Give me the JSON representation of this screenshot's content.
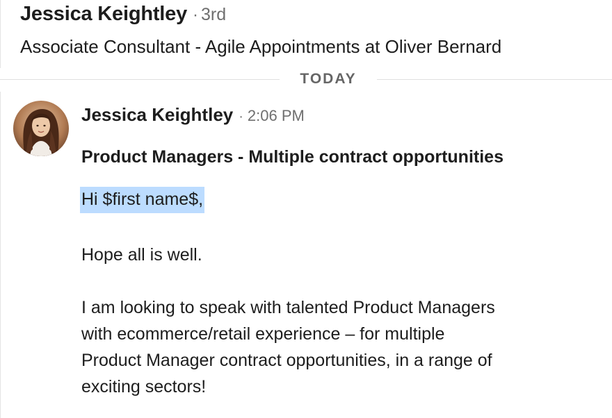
{
  "header": {
    "name": "Jessica Keightley",
    "separator": "·",
    "degree": "3rd",
    "headline": "Associate Consultant - Agile Appointments at Oliver Bernard"
  },
  "divider": {
    "label": "TODAY"
  },
  "message": {
    "avatar_icon": "profile-photo",
    "sender": "Jessica Keightley",
    "separator": "·",
    "time": "2:06 PM",
    "subject": "Product Managers - Multiple contract opportunities",
    "greeting": "Hi $first name$,",
    "paragraph_1": "Hope all is well.",
    "paragraph_2_lines": [
      "I am looking to speak with talented Product Managers",
      "with ecommerce/retail experience – for multiple",
      "Product Manager contract opportunities, in a range of",
      "exciting sectors!"
    ]
  },
  "colors": {
    "text": "#1d1d1d",
    "muted": "#6f6f6f",
    "selection": "#bcdcff",
    "divider": "#e0e0e0"
  }
}
